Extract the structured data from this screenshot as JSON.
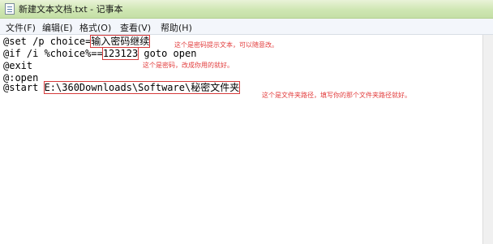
{
  "window": {
    "title": "新建文本文档.txt - 记事本",
    "icon": "notepad-icon"
  },
  "menu": {
    "items": [
      "文件(F)",
      "编辑(E)",
      "格式(O)",
      "查看(V)",
      "帮助(H)"
    ]
  },
  "editor": {
    "lines": [
      {
        "prefix": "@set /p choice=",
        "highlight": "输入密码继续",
        "suffix": ""
      },
      {
        "prefix": "@if /i %choice%==",
        "highlight": "123123",
        "suffix": " goto open"
      },
      {
        "prefix": "@exit",
        "highlight": "",
        "suffix": ""
      },
      {
        "prefix": "@:open",
        "highlight": "",
        "suffix": ""
      },
      {
        "prefix": "@start ",
        "highlight": "E:\\360Downloads\\Software\\秘密文件夹",
        "suffix": ""
      }
    ]
  },
  "annotations": {
    "prompt_note": "这个是密码提示文本，可以随意改。",
    "password_note": "这个是密码，改成你用的就好。",
    "path_note": "这个是文件夹路径，填写你的那个文件夹路径就好。"
  },
  "colors": {
    "annotation": "#e23b3b",
    "box": "#d63b3b",
    "titlebar": "#cfe6b3"
  }
}
